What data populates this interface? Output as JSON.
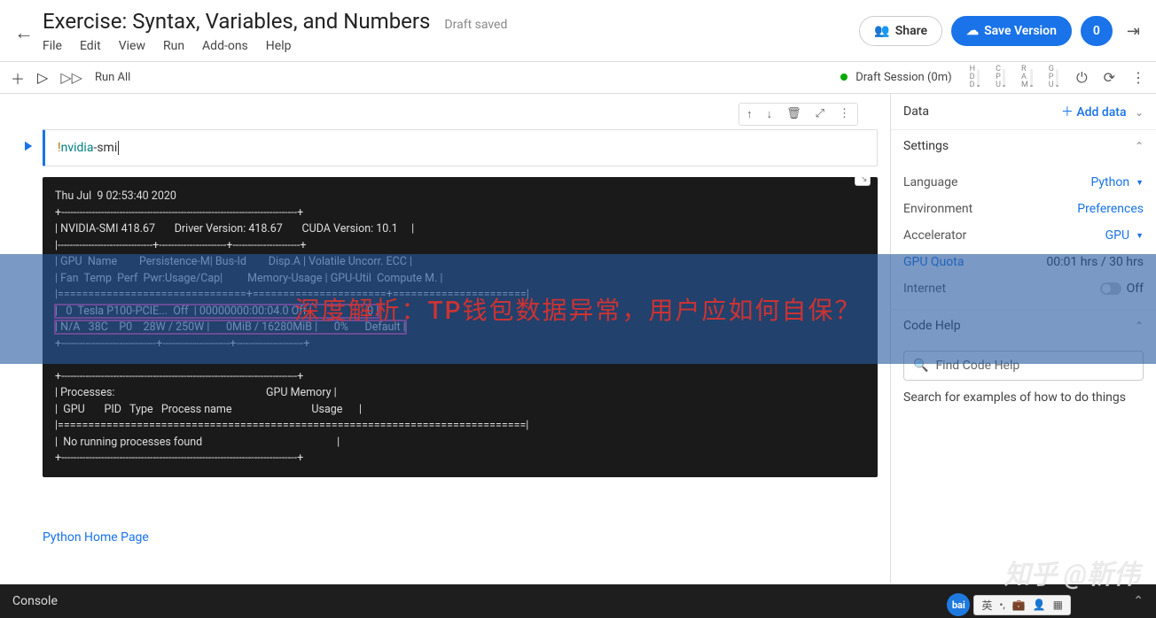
{
  "header": {
    "title": "Exercise: Syntax, Variables, and Numbers",
    "status": "Draft saved",
    "menu": [
      "File",
      "Edit",
      "View",
      "Run",
      "Add-ons",
      "Help"
    ],
    "share_label": "Share",
    "save_label": "Save Version",
    "version_count": "0"
  },
  "toolbar": {
    "run_all": "Run All",
    "session_label": "Draft Session (0m)",
    "meters": [
      "HDD",
      "CPU",
      "RAM",
      "GPU"
    ]
  },
  "cell": {
    "code_bang": "!",
    "code_cmd": "nvidia",
    "code_rest": "-smi",
    "output": "Thu Jul  9 02:53:40 2020\n+-----------------------------------------------------------------------------+\n| NVIDIA-SMI 418.67       Driver Version: 418.67       CUDA Version: 10.1     |\n|-------------------------------+----------------------+----------------------+\n| GPU  Name        Persistence-M| Bus-Id        Disp.A | Volatile Uncorr. ECC |\n| Fan  Temp  Perf  Pwr:Usage/Cap|         Memory-Usage | GPU-Util  Compute M. |\n|===============================+======================+======================|",
    "output_gpu_row": "|   0  Tesla P100-PCIE...  Off  | 00000000:00:04.0 Off |                    0 |\n| N/A   38C    P0    28W / 250W |      0MiB / 16280MiB |      0%      Default |",
    "output_after": "+-------------------------------+----------------------+----------------------+\n\n+-----------------------------------------------------------------------------+\n| Processes:                                                       GPU Memory |\n|  GPU       PID   Type   Process name                             Usage      |\n|=============================================================================|\n|  No running processes found                                                 |\n+-----------------------------------------------------------------------------+"
  },
  "link_cell": {
    "text": "Python Home Page"
  },
  "overlay": {
    "text": "深度解析：TP钱包数据异常，用户应如何自保？"
  },
  "right_panel": {
    "data_title": "Data",
    "add_data": "Add data",
    "settings_title": "Settings",
    "language_label": "Language",
    "language_value": "Python",
    "environment_label": "Environment",
    "environment_value": "Preferences",
    "accelerator_label": "Accelerator",
    "accelerator_value": "GPU",
    "gpu_quota_label": "GPU Quota",
    "gpu_quota_value": "00:01 hrs / 30 hrs",
    "internet_label": "Internet",
    "internet_value": "Off",
    "code_help_title": "Code Help",
    "code_help_placeholder": "Find Code Help",
    "code_help_desc": "Search for examples of how to do things"
  },
  "console": {
    "label": "Console"
  },
  "watermark": "知乎 @靳伟",
  "ime": {
    "badge": "bai",
    "lang": "英"
  }
}
